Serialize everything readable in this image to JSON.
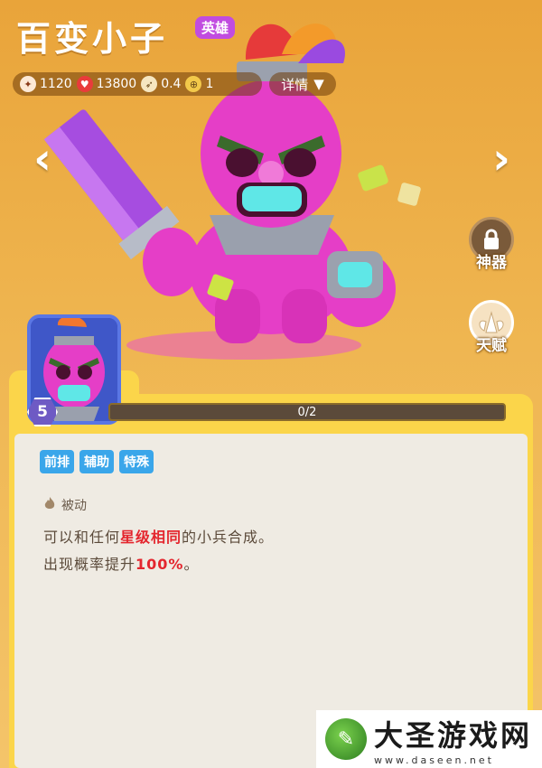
{
  "hero": {
    "name": "百变小子",
    "rarity": "英雄",
    "level": "5",
    "progress": "0/2",
    "progress_fraction": 0
  },
  "stats": [
    {
      "icon": "attack-icon",
      "value": "1120"
    },
    {
      "icon": "heart-icon",
      "value": "13800"
    },
    {
      "icon": "speed-icon",
      "value": "0.4"
    },
    {
      "icon": "range-icon",
      "value": "1"
    }
  ],
  "details_label": "详情",
  "side": {
    "artifact_label": "神器",
    "talent_label": "天赋"
  },
  "tags": [
    "前排",
    "辅助",
    "特殊"
  ],
  "skill": {
    "type_label": "被动",
    "line1_pre": "可以和任何",
    "line1_hl": "星级相同",
    "line1_post": "的小兵合成。",
    "line2_pre": "出现概率提升",
    "line2_hl": "100%",
    "line2_post": "。"
  },
  "watermark": {
    "title": "大圣游戏网",
    "url": "www.daseen.net"
  },
  "colors": {
    "background": "#efb651",
    "panel": "#fbd54a",
    "hero_badge": "#c14ce0",
    "tag": "#3aa6ea",
    "highlight": "#e4262e"
  }
}
